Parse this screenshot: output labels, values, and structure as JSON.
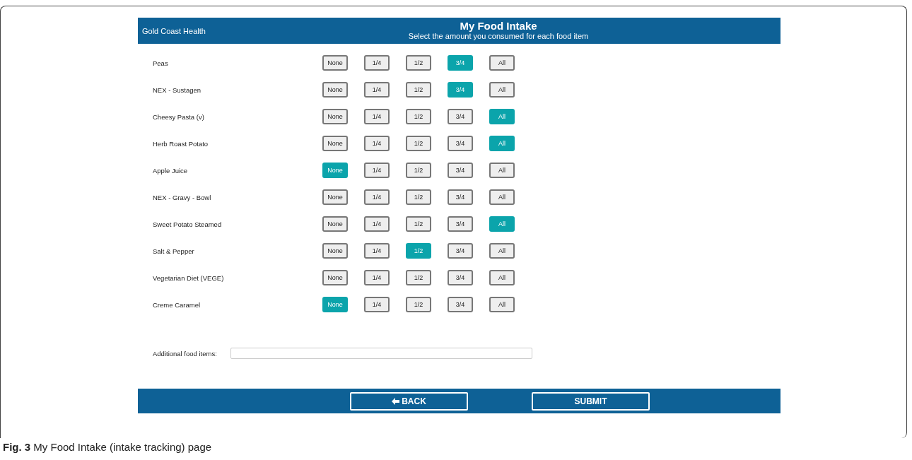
{
  "header": {
    "brand": "Gold Coast Health",
    "title": "My Food Intake",
    "subtitle": "Select the amount you consumed for each food item"
  },
  "food_items": [
    {
      "name": "Peas",
      "options": [
        {
          "label": "None",
          "selected": false
        },
        {
          "label": "1/4",
          "selected": false
        },
        {
          "label": "1/2",
          "selected": false
        },
        {
          "label": "3/4",
          "selected": true
        },
        {
          "label": "All",
          "selected": false
        }
      ]
    },
    {
      "name": "NEX - Sustagen",
      "options": [
        {
          "label": "None",
          "selected": false
        },
        {
          "label": "1/4",
          "selected": false
        },
        {
          "label": "1/2",
          "selected": false
        },
        {
          "label": "3/4",
          "selected": true
        },
        {
          "label": "All",
          "selected": false
        }
      ]
    },
    {
      "name": "Cheesy Pasta (v)",
      "options": [
        {
          "label": "None",
          "selected": false
        },
        {
          "label": "1/4",
          "selected": false
        },
        {
          "label": "1/2",
          "selected": false
        },
        {
          "label": "3/4",
          "selected": false
        },
        {
          "label": "All",
          "selected": true
        }
      ]
    },
    {
      "name": "Herb Roast Potato",
      "options": [
        {
          "label": "None",
          "selected": false
        },
        {
          "label": "1/4",
          "selected": false
        },
        {
          "label": "1/2",
          "selected": false
        },
        {
          "label": "3/4",
          "selected": false
        },
        {
          "label": "All",
          "selected": true
        }
      ]
    },
    {
      "name": "Apple Juice",
      "options": [
        {
          "label": "None",
          "selected": true
        },
        {
          "label": "1/4",
          "selected": false
        },
        {
          "label": "1/2",
          "selected": false
        },
        {
          "label": "3/4",
          "selected": false
        },
        {
          "label": "All",
          "selected": false
        }
      ]
    },
    {
      "name": "NEX - Gravy - Bowl",
      "options": [
        {
          "label": "None",
          "selected": false
        },
        {
          "label": "1/4",
          "selected": false
        },
        {
          "label": "1/2",
          "selected": false
        },
        {
          "label": "3/4",
          "selected": false
        },
        {
          "label": "All",
          "selected": false
        }
      ]
    },
    {
      "name": "Sweet Potato Steamed",
      "options": [
        {
          "label": "None",
          "selected": false
        },
        {
          "label": "1/4",
          "selected": false
        },
        {
          "label": "1/2",
          "selected": false
        },
        {
          "label": "3/4",
          "selected": false
        },
        {
          "label": "All",
          "selected": true
        }
      ]
    },
    {
      "name": "Salt & Pepper",
      "options": [
        {
          "label": "None",
          "selected": false
        },
        {
          "label": "1/4",
          "selected": false
        },
        {
          "label": "1/2",
          "selected": true
        },
        {
          "label": "3/4",
          "selected": false
        },
        {
          "label": "All",
          "selected": false
        }
      ]
    },
    {
      "name": "Vegetarian Diet (VEGE)",
      "options": [
        {
          "label": "None",
          "selected": false
        },
        {
          "label": "1/4",
          "selected": false
        },
        {
          "label": "1/2",
          "selected": false
        },
        {
          "label": "3/4",
          "selected": false
        },
        {
          "label": "All",
          "selected": false
        }
      ]
    },
    {
      "name": "Creme Caramel",
      "options": [
        {
          "label": "None",
          "selected": true
        },
        {
          "label": "1/4",
          "selected": false
        },
        {
          "label": "1/2",
          "selected": false
        },
        {
          "label": "3/4",
          "selected": false
        },
        {
          "label": "All",
          "selected": false
        }
      ]
    }
  ],
  "additional": {
    "label": "Additional food items:"
  },
  "footer": {
    "back": "BACK",
    "submit": "SUBMIT"
  },
  "caption": {
    "figure": "Fig. 3",
    "text": "My Food Intake (intake tracking) page"
  }
}
